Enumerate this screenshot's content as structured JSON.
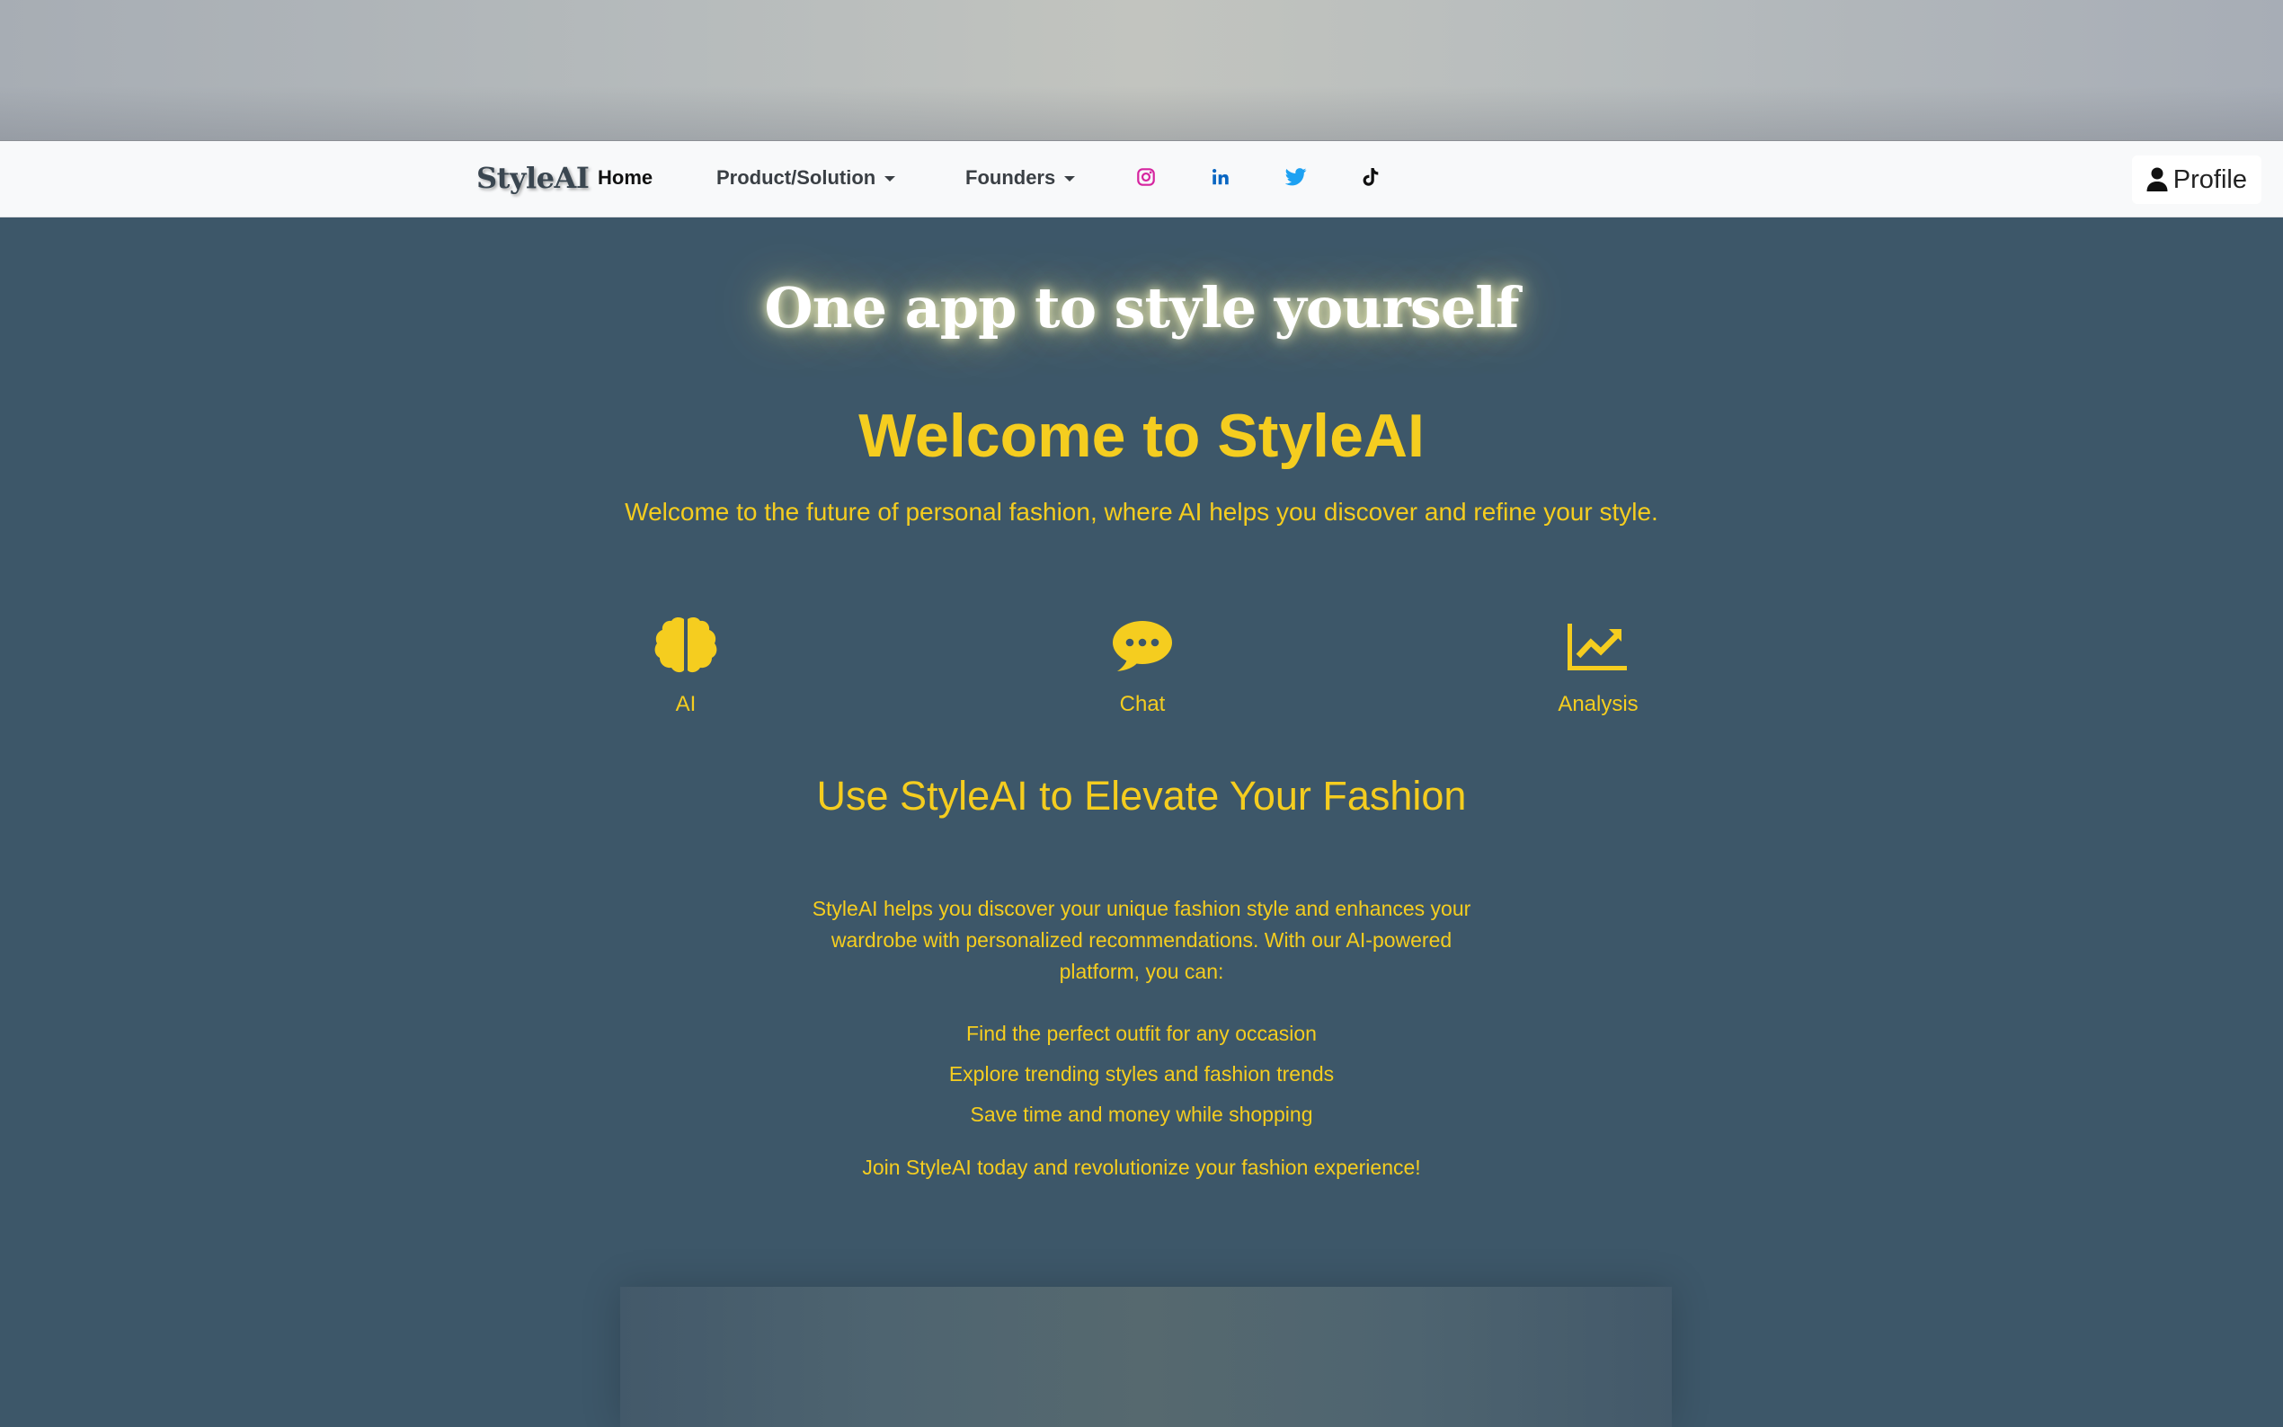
{
  "navbar": {
    "brand": "StyleAI",
    "links": [
      {
        "label": "Home"
      },
      {
        "label": "Product/Solution"
      },
      {
        "label": "Founders"
      }
    ],
    "social_icons": [
      "instagram-icon",
      "linkedin-icon",
      "twitter-icon",
      "tiktok-icon"
    ],
    "profile_label": "Profile"
  },
  "hero": {
    "tagline": "One app to style yourself",
    "title": "Welcome to StyleAI",
    "subtitle": "Welcome to the future of personal fashion, where AI helps you discover and refine your style."
  },
  "features": [
    {
      "icon": "brain-icon",
      "label": "AI"
    },
    {
      "icon": "chat-icon",
      "label": "Chat"
    },
    {
      "icon": "chart-line-icon",
      "label": "Analysis"
    }
  ],
  "about": {
    "title": "Use StyleAI to Elevate Your Fashion",
    "paragraph": "StyleAI helps you discover your unique fashion style and enhances your wardrobe with personalized recommendations. With our AI-powered platform, you can:",
    "bullets": [
      "Find the perfect outfit for any occasion",
      "Explore trending styles and fashion trends",
      "Save time and money while shopping"
    ],
    "closing": "Join StyleAI today and revolutionize your fashion experience!"
  },
  "colors": {
    "accent": "#f5cd1f",
    "background": "#3d5769",
    "navbar": "#f8f9fa",
    "instagram": "#d6249f",
    "linkedin": "#0a66c2",
    "twitter": "#1da1f2"
  }
}
